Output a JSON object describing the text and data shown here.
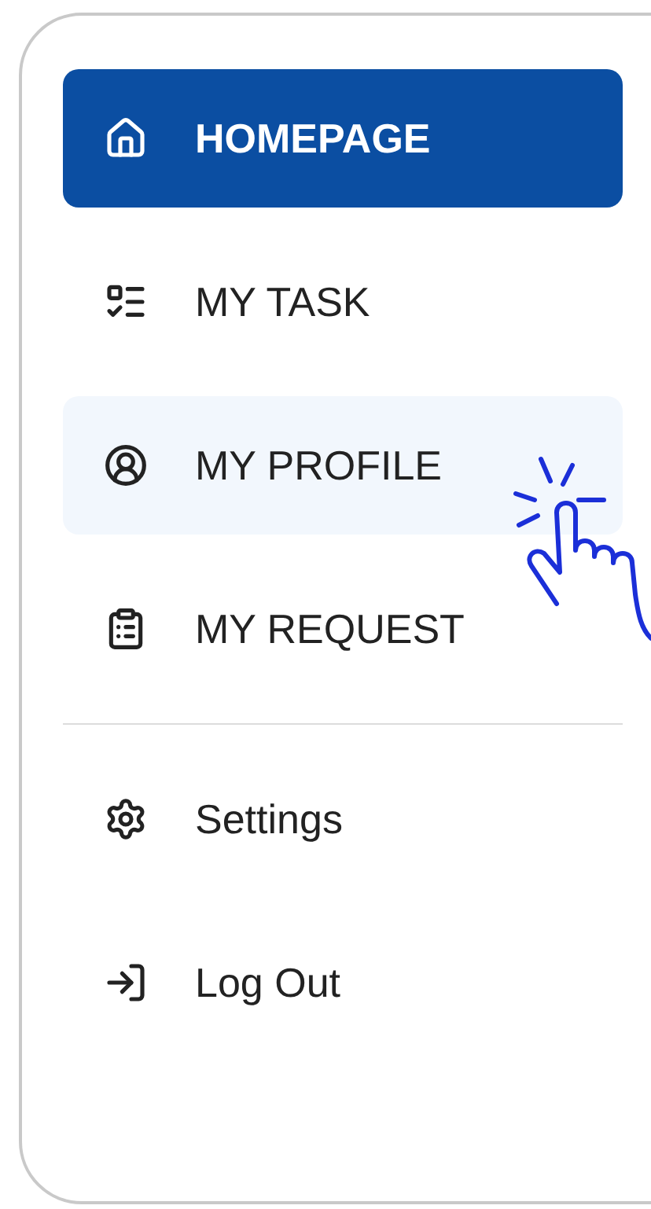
{
  "menu": {
    "items": [
      {
        "label": "HOMEPAGE",
        "selected": true,
        "hovered": false
      },
      {
        "label": "MY TASK",
        "selected": false,
        "hovered": false
      },
      {
        "label": "MY PROFILE",
        "selected": false,
        "hovered": true
      },
      {
        "label": "MY REQUEST",
        "selected": false,
        "hovered": false
      }
    ]
  },
  "footer": {
    "items": [
      {
        "label": "Settings",
        "selected": false
      },
      {
        "label": "Log Out",
        "selected": false
      }
    ]
  }
}
